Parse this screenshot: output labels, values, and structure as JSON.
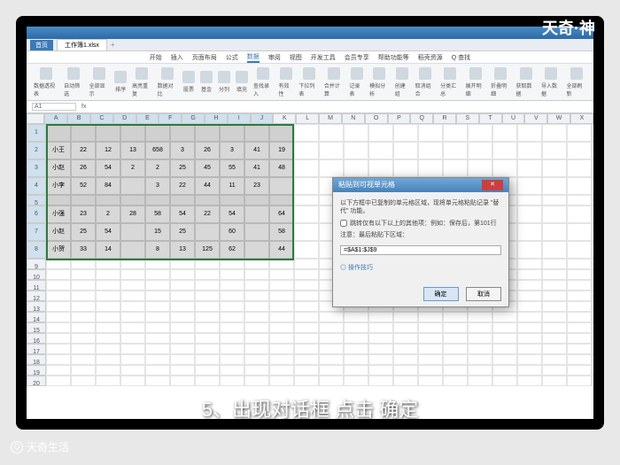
{
  "brand": "天奇·神",
  "file_button": "首页",
  "doc_tab": "工作簿1.xlsx",
  "tabs": [
    "开始",
    "插入",
    "页面布局",
    "公式",
    "数据",
    "审阅",
    "视图",
    "开发工具",
    "会员专享",
    "帮助功能等",
    "稻壳资源",
    "Q 查找"
  ],
  "active_tab": "数据",
  "ribbon_groups": [
    "数据透视表",
    "自动筛选",
    "全部显示",
    "排序",
    "高亮重复",
    "数据对比",
    "股票",
    "基金",
    "分列",
    "填充",
    "查找录入",
    "有效性",
    "下拉列表",
    "合并计算",
    "记录表",
    "模拟分析",
    "创建组",
    "取消组合",
    "分类汇总",
    "展开明细",
    "折叠明细",
    "获取数据",
    "导入数据",
    "全部刷新"
  ],
  "name_box": "A1",
  "col_letters": [
    "A",
    "B",
    "C",
    "D",
    "E",
    "F",
    "G",
    "H",
    "I",
    "J",
    "K",
    "L",
    "M",
    "N",
    "O",
    "P",
    "Q",
    "R",
    "S",
    "T",
    "U",
    "V",
    "W",
    "X"
  ],
  "table": {
    "header": [
      "",
      "",
      "",
      "",
      "",
      "",
      "",
      "",
      "",
      ""
    ],
    "rows": [
      [
        "小王",
        "22",
        "12",
        "13",
        "658",
        "3",
        "26",
        "3",
        "41",
        "19"
      ],
      [
        "小赵",
        "26",
        "54",
        "2",
        "2",
        "25",
        "45",
        "55",
        "41",
        "48"
      ],
      [
        "小李",
        "52",
        "84",
        "",
        "3",
        "22",
        "44",
        "11",
        "23",
        ""
      ],
      [
        "",
        "",
        "",
        "",
        "",
        "",
        "",
        "",
        "",
        ""
      ],
      [
        "小强",
        "23",
        "2",
        "28",
        "58",
        "54",
        "22",
        "54",
        "",
        "64"
      ],
      [
        "小赵",
        "25",
        "54",
        "",
        "15",
        "25",
        "",
        "60",
        "",
        "58"
      ],
      [
        "小贺",
        "33",
        "14",
        "",
        "8",
        "13",
        "125",
        "62",
        "",
        "44"
      ]
    ]
  },
  "dialog": {
    "title": "粘贴到可视单元格",
    "text1": "以下方框中已复制的单元格区域，现将单元格粘贴记录 \"替代\" 功能。",
    "checkbox_label": "跳转仅有以下以上的其他项：例如：保存后，第101行",
    "text2": "注意：最后粘贴下区域：",
    "input_value": "=$A$1:$J$9",
    "help_link": "◎ 操作技巧",
    "ok": "确定",
    "cancel": "取消"
  },
  "caption": "5、出现对话框 点击 确定",
  "watermark": "天奇生活"
}
